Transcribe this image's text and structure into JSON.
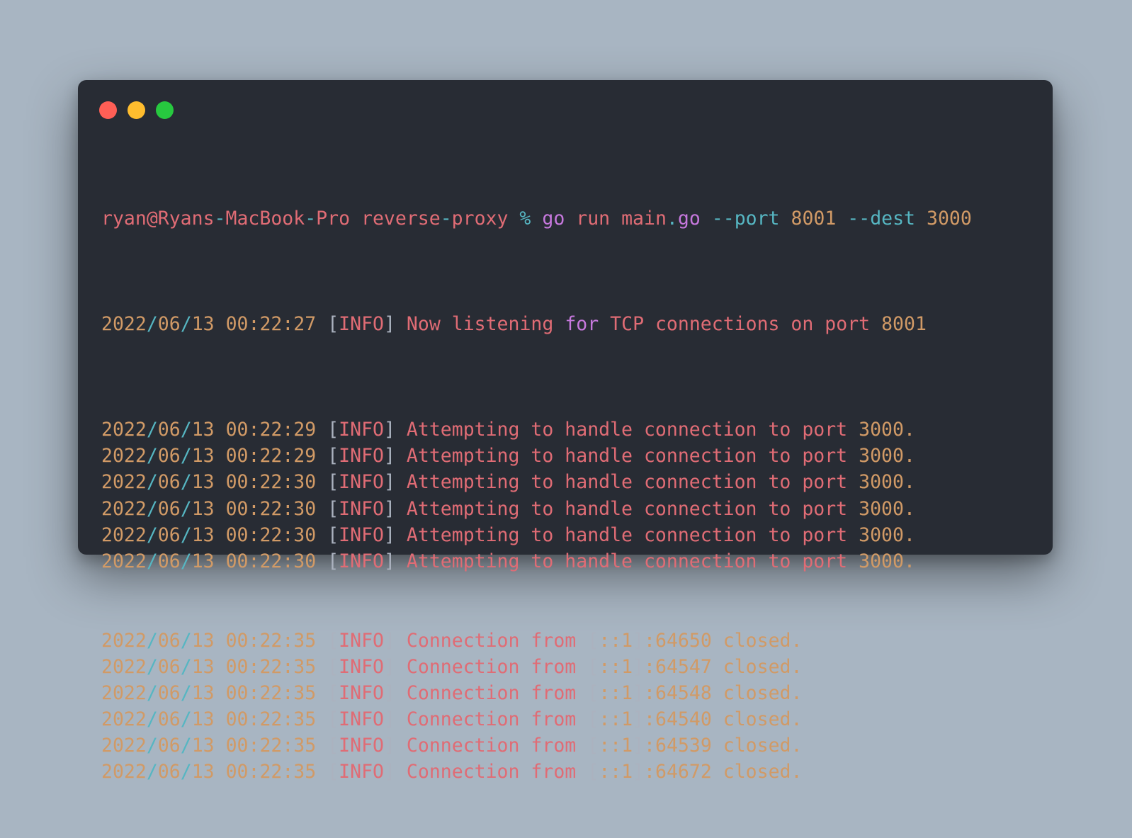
{
  "prompt": {
    "user": "ryan@Ryans",
    "sep1": "-",
    "host1": "MacBook",
    "sep2": "-",
    "host2": "Pro",
    "dir1": "reverse",
    "sep3": "-",
    "dir2": "proxy",
    "symbol": "%",
    "cmd_go": "go",
    "cmd_run": "run",
    "cmd_file": "main",
    "cmd_dot": ".",
    "cmd_ext": "go",
    "flag_port": "--port",
    "port_value": "8001",
    "flag_dest": "--dest",
    "dest_value": "3000"
  },
  "first_log": {
    "year": "2022",
    "month": "06",
    "day": "13",
    "time": "00:22:27",
    "level": "INFO",
    "msg_a": "Now listening",
    "msg_for": "for",
    "msg_b": "TCP connections on port",
    "msg_port": "8001"
  },
  "attempt_logs": [
    {
      "year": "2022",
      "month": "06",
      "day": "13",
      "time": "00:22:29",
      "level": "INFO",
      "msg": "Attempting to handle connection to port",
      "port": "3000."
    },
    {
      "year": "2022",
      "month": "06",
      "day": "13",
      "time": "00:22:29",
      "level": "INFO",
      "msg": "Attempting to handle connection to port",
      "port": "3000."
    },
    {
      "year": "2022",
      "month": "06",
      "day": "13",
      "time": "00:22:30",
      "level": "INFO",
      "msg": "Attempting to handle connection to port",
      "port": "3000."
    },
    {
      "year": "2022",
      "month": "06",
      "day": "13",
      "time": "00:22:30",
      "level": "INFO",
      "msg": "Attempting to handle connection to port",
      "port": "3000."
    },
    {
      "year": "2022",
      "month": "06",
      "day": "13",
      "time": "00:22:30",
      "level": "INFO",
      "msg": "Attempting to handle connection to port",
      "port": "3000."
    },
    {
      "year": "2022",
      "month": "06",
      "day": "13",
      "time": "00:22:30",
      "level": "INFO",
      "msg": "Attempting to handle connection to port",
      "port": "3000."
    }
  ],
  "closed_logs": [
    {
      "year": "2022",
      "month": "06",
      "day": "13",
      "time": "00:22:35",
      "level": "INFO",
      "msg": "Connection from",
      "addr": "::1",
      "port": "64650",
      "status": "closed."
    },
    {
      "year": "2022",
      "month": "06",
      "day": "13",
      "time": "00:22:35",
      "level": "INFO",
      "msg": "Connection from",
      "addr": "::1",
      "port": "64547",
      "status": "closed."
    },
    {
      "year": "2022",
      "month": "06",
      "day": "13",
      "time": "00:22:35",
      "level": "INFO",
      "msg": "Connection from",
      "addr": "::1",
      "port": "64548",
      "status": "closed."
    },
    {
      "year": "2022",
      "month": "06",
      "day": "13",
      "time": "00:22:35",
      "level": "INFO",
      "msg": "Connection from",
      "addr": "::1",
      "port": "64540",
      "status": "closed."
    },
    {
      "year": "2022",
      "month": "06",
      "day": "13",
      "time": "00:22:35",
      "level": "INFO",
      "msg": "Connection from",
      "addr": "::1",
      "port": "64539",
      "status": "closed."
    },
    {
      "year": "2022",
      "month": "06",
      "day": "13",
      "time": "00:22:35",
      "level": "INFO",
      "msg": "Connection from",
      "addr": "::1",
      "port": "64672",
      "status": "closed."
    }
  ],
  "colors": {
    "background": "#a8b5c2",
    "terminal": "#282c34",
    "red": "#e06c75",
    "orange": "#d19a66",
    "cyan": "#56b6c2",
    "purple": "#c678dd",
    "gray": "#abb2bf",
    "close": "#ff5f56",
    "minimize": "#ffbd2e",
    "zoom": "#27c93f"
  }
}
